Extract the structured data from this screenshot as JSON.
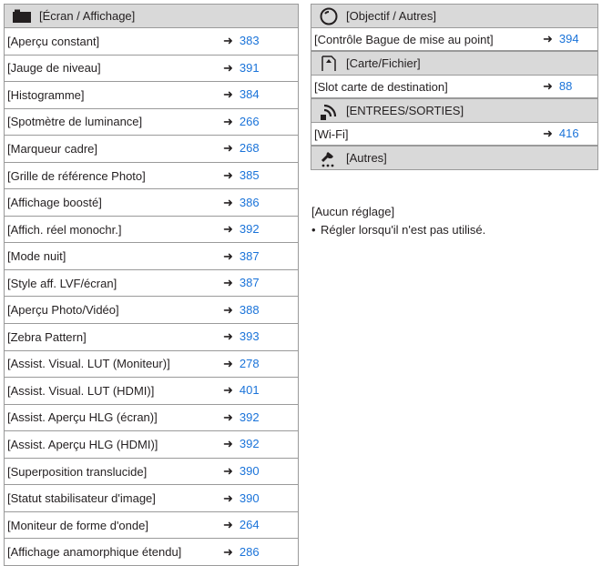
{
  "left": {
    "header": {
      "icon": "monitor-icon",
      "label": "[Écran / Affichage]"
    },
    "rows": [
      {
        "label": "[Aperçu constant]",
        "page": "383"
      },
      {
        "label": "[Jauge de niveau]",
        "page": "391"
      },
      {
        "label": "[Histogramme]",
        "page": "384"
      },
      {
        "label": "[Spotmètre de luminance]",
        "page": "266"
      },
      {
        "label": "[Marqueur cadre]",
        "page": "268"
      },
      {
        "label": "[Grille de référence Photo]",
        "page": "385"
      },
      {
        "label": "[Affichage boosté]",
        "page": "386"
      },
      {
        "label": "[Affich. réel monochr.]",
        "page": "392"
      },
      {
        "label": "[Mode nuit]",
        "page": "387"
      },
      {
        "label": "[Style aff. LVF/écran]",
        "page": "387"
      },
      {
        "label": "[Aperçu Photo/Vidéo]",
        "page": "388"
      },
      {
        "label": "[Zebra Pattern]",
        "page": "393"
      },
      {
        "label": "[Assist. Visual. LUT (Moniteur)]",
        "page": "278"
      },
      {
        "label": "[Assist. Visual. LUT (HDMI)]",
        "page": "401"
      },
      {
        "label": "[Assist. Aperçu HLG (écran)]",
        "page": "392"
      },
      {
        "label": "[Assist. Aperçu HLG (HDMI)]",
        "page": "392"
      },
      {
        "label": "[Superposition translucide]",
        "page": "390"
      },
      {
        "label": "[Statut stabilisateur d'image]",
        "page": "390"
      },
      {
        "label": "[Moniteur de forme d'onde]",
        "page": "264"
      },
      {
        "label": "[Affichage anamorphique étendu]",
        "page": "286"
      }
    ]
  },
  "right": {
    "sections": [
      {
        "icon": "lens-icon",
        "header": "[Objectif / Autres]",
        "row": {
          "label": "[Contrôle Bague de mise au point]",
          "page": "394"
        }
      },
      {
        "icon": "card-icon",
        "header": "[Carte/Fichier]",
        "row": {
          "label": "[Slot carte de destination]",
          "page": "88"
        }
      },
      {
        "icon": "wireless-icon",
        "header": "[ENTREES/SORTIES]",
        "row": {
          "label": "[Wi-Fi]",
          "page": "416"
        }
      },
      {
        "icon": "wrench-icon",
        "header": "[Autres]"
      }
    ],
    "note_title": "[Aucun réglage]",
    "note_bullet": "Régler lorsqu'il n'est pas utilisé."
  },
  "arrow_glyph": "➜"
}
